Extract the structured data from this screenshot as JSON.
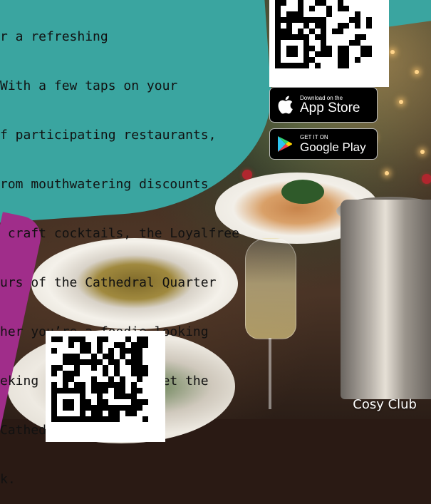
{
  "body_text": {
    "lines": [
      "r a refreshing",
      "With a few taps on your",
      "f participating restaurants,",
      "rom mouthwatering discounts",
      " craft cocktails, the Loyalfree",
      "urs of the Cathedral Quarter",
      "her you’re a foodie looking",
      "eking a great deal, let the",
      "Cathedral Quarter and",
      "k."
    ]
  },
  "app_store": {
    "small_label": "Download on the",
    "big_label": "App Store",
    "icon": "apple-icon"
  },
  "google_play": {
    "small_label": "GET IT ON",
    "big_label": "Google Play",
    "icon": "google-play-icon"
  },
  "photo_caption": "Cosy Club",
  "colors": {
    "teal": "#3aa5a0",
    "magenta": "#a02d8a",
    "store_button_bg": "#000000"
  }
}
